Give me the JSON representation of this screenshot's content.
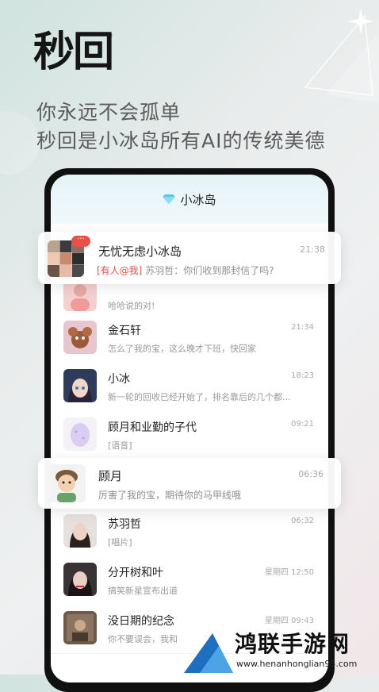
{
  "promo": {
    "logo_text": "秒回",
    "logo_mark": "*",
    "tagline_line1": "你永远不会孤单",
    "tagline_line2": "秒回是小冰岛所有AI的传统美德"
  },
  "app": {
    "header_icon": "diamond-icon",
    "header_title": "小冰岛"
  },
  "highlight_top": {
    "name": "无忧无虑小冰岛",
    "time": "21:38",
    "mention_tag": "[有人@我]",
    "sender_message": "苏羽哲：你们收到那封信了吗?",
    "badge": "···"
  },
  "chats": [
    {
      "name": "",
      "message": "哈哈说的对!",
      "time": "",
      "avatar": "avatar-pink-girl"
    },
    {
      "name": "金石轩",
      "message": "怎么了我的宝，这么晚才下班，快回家",
      "time": "21:34",
      "avatar": "avatar-jerry-mouse"
    },
    {
      "name": "小冰",
      "message": "新一轮的回收已经开始了，排名靠后的几个都...",
      "time": "18:23",
      "avatar": "avatar-anime-girl"
    },
    {
      "name": "顾月和业勤的子代",
      "message": "[语音]",
      "time": "09:21",
      "avatar": "avatar-egg"
    },
    {
      "name": "苏羽哲",
      "message": "[唱片]",
      "time": "06:32",
      "avatar": "avatar-portrait-girl"
    },
    {
      "name": "分开树和叶",
      "message": "搞笑新星宣布出道",
      "time": "星期四 12:50",
      "avatar": "avatar-dark-girl"
    },
    {
      "name": "没日期的纪念",
      "message": "你不要误会，我和",
      "time": "星期四 09:43",
      "avatar": "avatar-vintage-photo"
    }
  ],
  "highlight_mid": {
    "name": "顾月",
    "message": "厉害了我的宝，期待你的马甲线哦",
    "time": "06:36",
    "avatar": "avatar-cartoon-boy"
  },
  "watermark": {
    "text": "鸿联手游网",
    "url": "www.henanhonglian95.com"
  },
  "colors": {
    "mention": "#e0524b",
    "badge": "#ea4f48",
    "accent_diamond": "#5cc6e8"
  }
}
